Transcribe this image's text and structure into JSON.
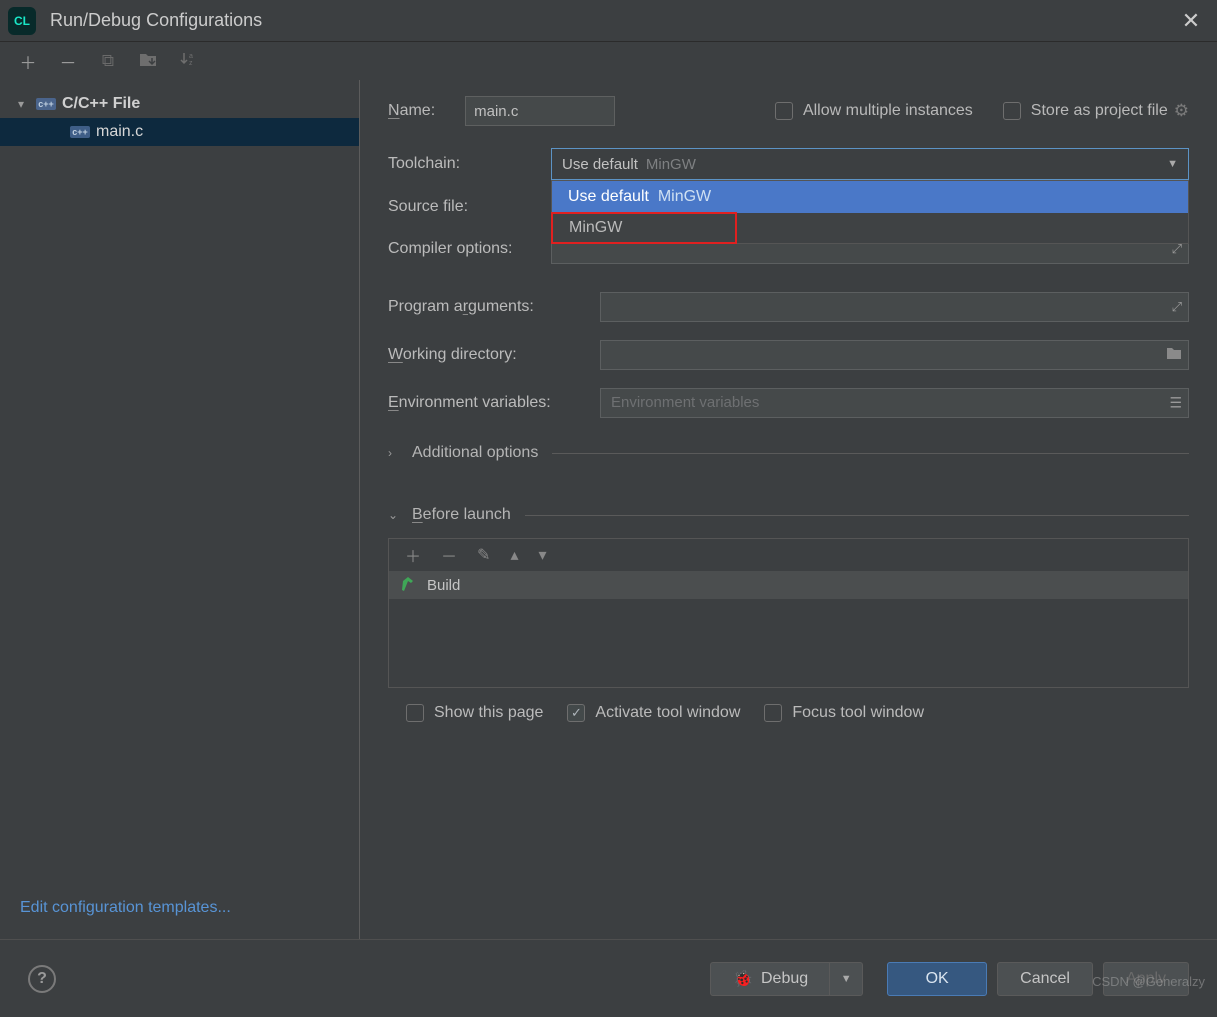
{
  "window": {
    "title": "Run/Debug Configurations"
  },
  "tree": {
    "group": "C/C++ File",
    "item": "main.c"
  },
  "edit_templates": "Edit configuration templates...",
  "form": {
    "name_label": "Name:",
    "name_value": "main.c",
    "allow_multiple": "Allow multiple instances",
    "store_project": "Store as project file",
    "toolchain_label": "Toolchain:",
    "toolchain_value_a": "Use default",
    "toolchain_value_b": "MinGW",
    "dropdown_opt1a": "Use default",
    "dropdown_opt1b": "MinGW",
    "dropdown_opt2": "MinGW",
    "source_file_label": "Source file:",
    "compiler_options_label": "Compiler options:",
    "program_args_label": "Program arguments:",
    "workdir_label": "Working directory:",
    "env_label": "Environment variables:",
    "env_placeholder": "Environment variables"
  },
  "sections": {
    "additional": "Additional options",
    "before_launch": "Before launch"
  },
  "before_launch": {
    "task": "Build",
    "show_page": "Show this page",
    "activate_tool": "Activate tool window",
    "focus_tool": "Focus tool window"
  },
  "buttons": {
    "debug": "Debug",
    "ok": "OK",
    "cancel": "Cancel",
    "apply": "Apply"
  },
  "watermark": "CSDN @Generalzy"
}
